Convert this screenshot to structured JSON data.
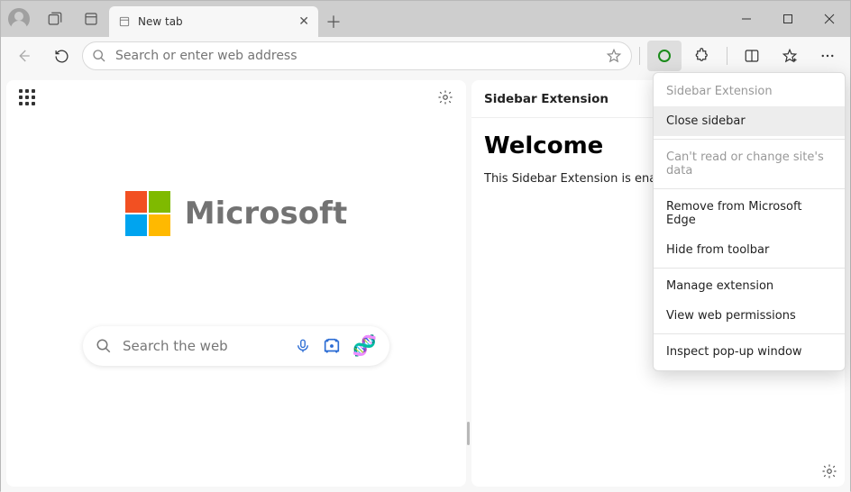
{
  "tab": {
    "title": "New tab"
  },
  "address": {
    "placeholder": "Search or enter web address"
  },
  "ntp": {
    "brand": "Microsoft",
    "search_placeholder": "Search the web"
  },
  "sidebar": {
    "title": "Sidebar Extension",
    "heading": "Welcome",
    "body": "This Sidebar Extension is enabled on a"
  },
  "context_menu": {
    "header": "Sidebar Extension",
    "items": [
      {
        "label": "Close sidebar",
        "disabled": false,
        "hover": true
      },
      {
        "label": "Can't read or change site's data",
        "disabled": true,
        "sep_before": true
      },
      {
        "label": "Remove from Microsoft Edge",
        "disabled": false,
        "sep_before": true
      },
      {
        "label": "Hide from toolbar",
        "disabled": false
      },
      {
        "label": "Manage extension",
        "disabled": false,
        "sep_before": true
      },
      {
        "label": "View web permissions",
        "disabled": false
      },
      {
        "label": "Inspect pop-up window",
        "disabled": false,
        "sep_before": true
      }
    ]
  }
}
